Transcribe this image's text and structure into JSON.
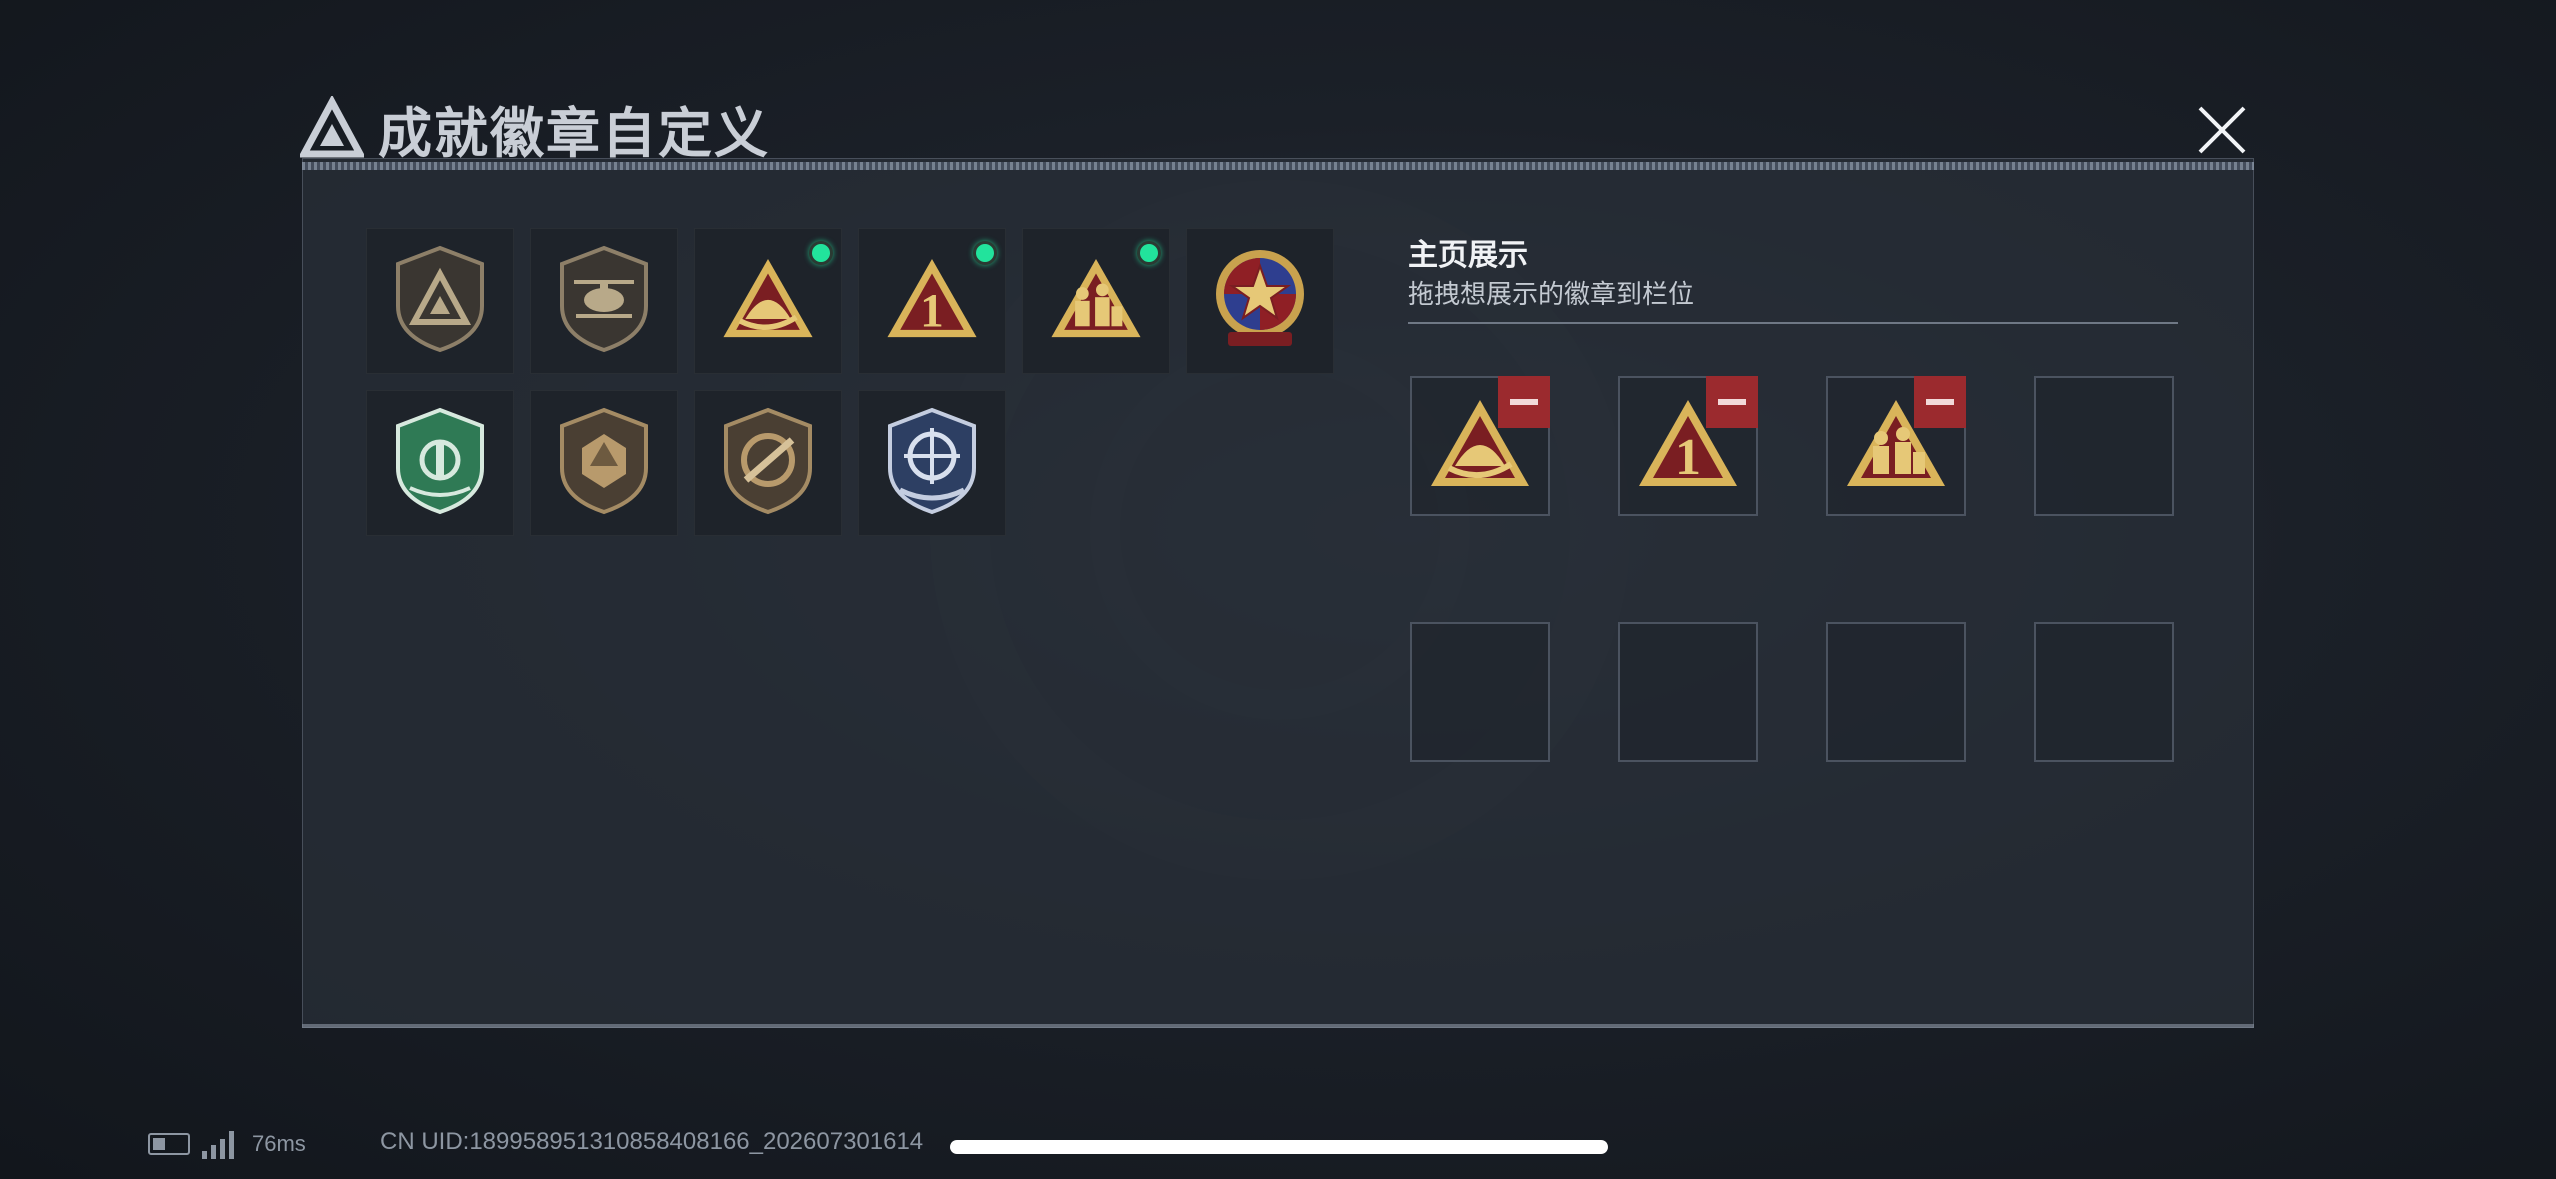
{
  "title": "成就徽章自定义",
  "header_small_text": "",
  "badges": [
    {
      "icon": "triangle-shield-badge-icon",
      "new": false
    },
    {
      "icon": "helicopter-badge-icon",
      "new": false
    },
    {
      "icon": "helmet-triangle-badge-icon",
      "new": true
    },
    {
      "icon": "number-one-triangle-badge-icon",
      "new": true
    },
    {
      "icon": "soldiers-triangle-badge-icon",
      "new": true
    },
    {
      "icon": "star-medal-badge-icon",
      "new": false
    },
    {
      "icon": "green-shield-badge-icon",
      "new": false
    },
    {
      "icon": "d20-shield-badge-icon",
      "new": false
    },
    {
      "icon": "rifle-shield-badge-icon",
      "new": false
    },
    {
      "icon": "crosshair-shield-badge-icon",
      "new": false
    }
  ],
  "showcase": {
    "title": "主页展示",
    "subtitle": "拖拽想展示的徽章到栏位",
    "slots": [
      {
        "icon": "helmet-triangle-badge-icon"
      },
      {
        "icon": "number-one-triangle-badge-icon"
      },
      {
        "icon": "soldiers-triangle-badge-icon"
      },
      {
        "icon": ""
      },
      {
        "icon": ""
      },
      {
        "icon": ""
      },
      {
        "icon": ""
      },
      {
        "icon": ""
      }
    ]
  },
  "status": {
    "ping": "76ms",
    "uid": "CN UID:18995895131085840816​6_202607301614"
  },
  "colors": {
    "accent_gold": "#d9b45a",
    "badge_red": "#8f1f25",
    "new_dot": "#22e39c",
    "remove_red": "#9b2a2e"
  }
}
